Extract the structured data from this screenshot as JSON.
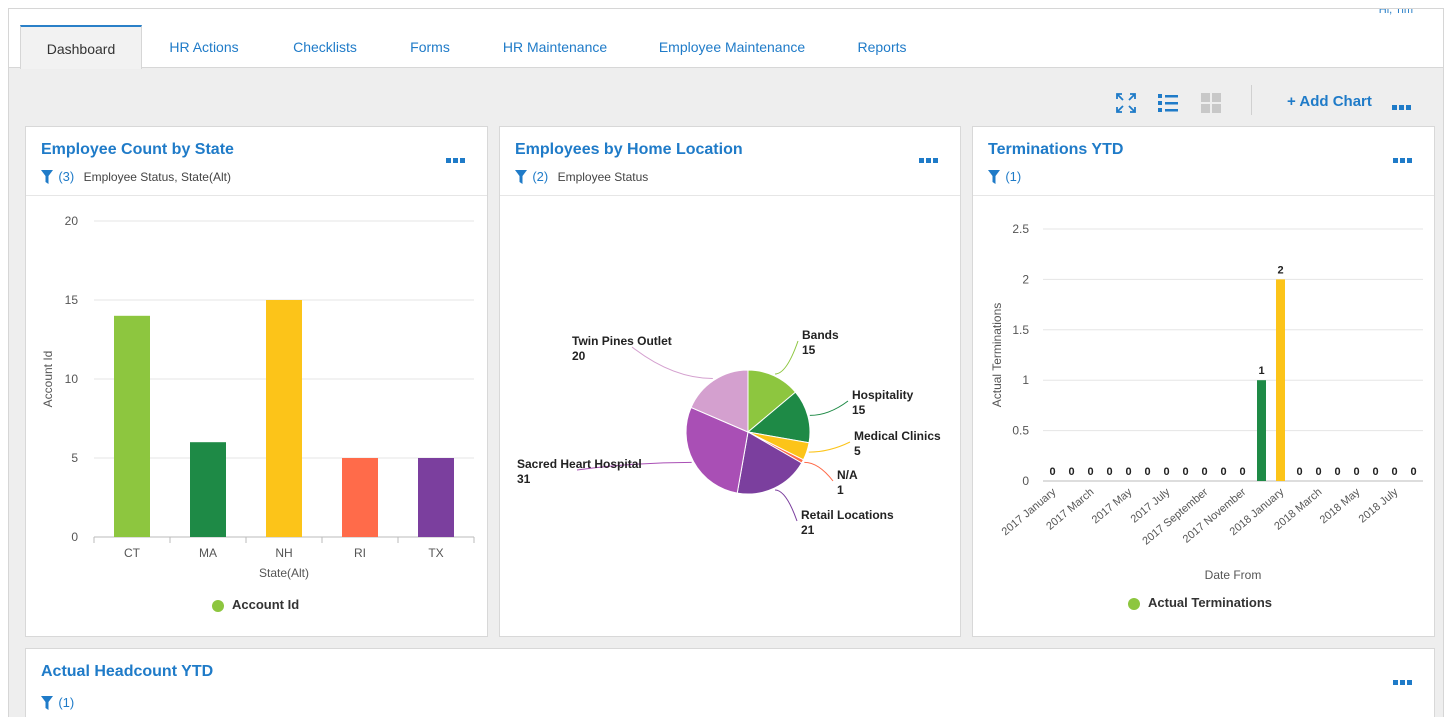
{
  "header": {
    "corner_text": "Hi, Tim"
  },
  "tabs": [
    {
      "label": "Dashboard",
      "active": true
    },
    {
      "label": "HR Actions"
    },
    {
      "label": "Checklists"
    },
    {
      "label": "Forms"
    },
    {
      "label": "HR Maintenance"
    },
    {
      "label": "Employee Maintenance"
    },
    {
      "label": "Reports"
    }
  ],
  "toolbar": {
    "icons": [
      "expand-icon",
      "list-view-icon",
      "grid-view-icon",
      "more-icon"
    ],
    "add_chart_label": "+ Add Chart"
  },
  "colors": {
    "accent": "#1f7bc8",
    "lightgreen": "#8dc63f",
    "darkgreen": "#1e8a46",
    "yellow": "#fcc419",
    "orange": "#ff6b4a",
    "purple": "#7b3f9e"
  },
  "cards": {
    "state": {
      "title": "Employee Count by State",
      "filter_count": "(3)",
      "filter_text": "Employee Status, State(Alt)",
      "legend": "Account Id"
    },
    "location": {
      "title": "Employees by Home Location",
      "filter_count": "(2)",
      "filter_text": "Employee Status"
    },
    "terminations": {
      "title": "Terminations YTD",
      "filter_count": "(1)",
      "legend": "Actual Terminations"
    },
    "headcount": {
      "title": "Actual Headcount YTD",
      "filter_count": "(1)"
    }
  },
  "chart_data": [
    {
      "type": "bar",
      "categories": [
        "CT",
        "MA",
        "NH",
        "RI",
        "TX"
      ],
      "values": [
        14,
        6,
        15,
        5,
        5
      ],
      "colors": [
        "#8dc63f",
        "#1e8a46",
        "#fcc419",
        "#ff6b4a",
        "#7b3f9e"
      ],
      "xlabel": "State(Alt)",
      "ylabel": "Account Id",
      "ylim": [
        0,
        20
      ],
      "yticks": [
        0,
        5,
        10,
        15,
        20
      ],
      "grid": true,
      "legend": "bottom-center"
    },
    {
      "type": "pie",
      "slices": [
        {
          "label": "Bands",
          "value": 15,
          "color": "#8dc63f"
        },
        {
          "label": "Hospitality",
          "value": 15,
          "color": "#1e8a46"
        },
        {
          "label": "Medical Clinics",
          "value": 5,
          "color": "#fcc419"
        },
        {
          "label": "N/A",
          "value": 1,
          "color": "#ff6b4a"
        },
        {
          "label": "Retail Locations",
          "value": 21,
          "color": "#7b3f9e"
        },
        {
          "label": "Sacred Heart Hospital",
          "value": 31,
          "color": "#a94fb5"
        },
        {
          "label": "Twin Pines Outlet",
          "value": 20,
          "color": "#d4a0cf"
        }
      ]
    },
    {
      "type": "bar",
      "categories": [
        "2017 January",
        "2017 February",
        "2017 March",
        "2017 April",
        "2017 May",
        "2017 June",
        "2017 July",
        "2017 August",
        "2017 September",
        "2017 October",
        "2017 November",
        "2017 December",
        "2018 January",
        "2018 February",
        "2018 March",
        "2018 April",
        "2018 May",
        "2018 June",
        "2018 July",
        "2018 August"
      ],
      "tick_labels": [
        "2017 January",
        "2017 March",
        "2017 May",
        "2017 July",
        "2017 September",
        "2017 November",
        "2018 January",
        "2018 March",
        "2018 May",
        "2018 July"
      ],
      "values": [
        0,
        0,
        0,
        0,
        0,
        0,
        0,
        0,
        0,
        0,
        0,
        1,
        2,
        0,
        0,
        0,
        0,
        0,
        0,
        0
      ],
      "bar_colors": {
        "11": "#1e8a46",
        "12": "#fcc419"
      },
      "xlabel": "Date From",
      "ylabel": "Actual Terminations",
      "ylim": [
        0,
        2.5
      ],
      "yticks": [
        0,
        0.5,
        1,
        1.5,
        2,
        2.5
      ],
      "grid": true,
      "legend": "bottom-center"
    }
  ]
}
